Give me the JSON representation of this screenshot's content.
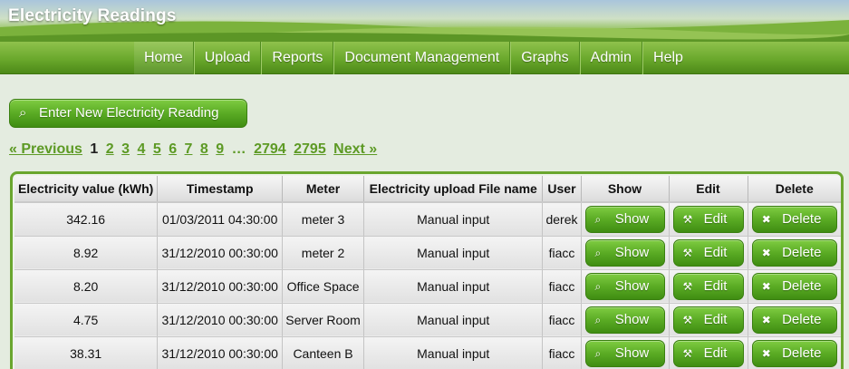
{
  "app": {
    "title": "Electricity Readings"
  },
  "nav": {
    "items": [
      {
        "label": "Home"
      },
      {
        "label": "Upload"
      },
      {
        "label": "Reports"
      },
      {
        "label": "Document Management"
      },
      {
        "label": "Graphs"
      },
      {
        "label": "Admin"
      },
      {
        "label": "Help"
      }
    ],
    "active": "Home"
  },
  "actions": {
    "new_reading_label": "Enter New Electricity Reading",
    "new_reading_icon": "search-icon"
  },
  "pagination": {
    "previous": "« Previous",
    "current": "1",
    "pages": [
      "2",
      "3",
      "4",
      "5",
      "6",
      "7",
      "8",
      "9"
    ],
    "ellipsis": "…",
    "last_pages": [
      "2794",
      "2795"
    ],
    "next": "Next »"
  },
  "table": {
    "headers": [
      "Electricity value (kWh)",
      "Timestamp",
      "Meter",
      "Electricity upload File name",
      "User",
      "Show",
      "Edit",
      "Delete"
    ],
    "button_labels": {
      "show": "Show",
      "edit": "Edit",
      "delete": "Delete"
    },
    "button_icons": {
      "show": "search-icon",
      "edit": "wrench-icon",
      "delete": "close-icon"
    },
    "rows": [
      {
        "value": "342.16",
        "timestamp": "01/03/2011 04:30:00",
        "meter": "meter 3",
        "file": "Manual input",
        "user": "derek"
      },
      {
        "value": "8.92",
        "timestamp": "31/12/2010 00:30:00",
        "meter": "meter 2",
        "file": "Manual input",
        "user": "fiacc"
      },
      {
        "value": "8.20",
        "timestamp": "31/12/2010 00:30:00",
        "meter": "Office Space",
        "file": "Manual input",
        "user": "fiacc"
      },
      {
        "value": "4.75",
        "timestamp": "31/12/2010 00:30:00",
        "meter": "Server Room",
        "file": "Manual input",
        "user": "fiacc"
      },
      {
        "value": "38.31",
        "timestamp": "31/12/2010 00:30:00",
        "meter": "Canteen B",
        "file": "Manual input",
        "user": "fiacc"
      }
    ]
  },
  "colors": {
    "accent": "#5aab24",
    "link": "#5d9a25",
    "nav": "#6aa82c",
    "background": "#e4ece0"
  }
}
